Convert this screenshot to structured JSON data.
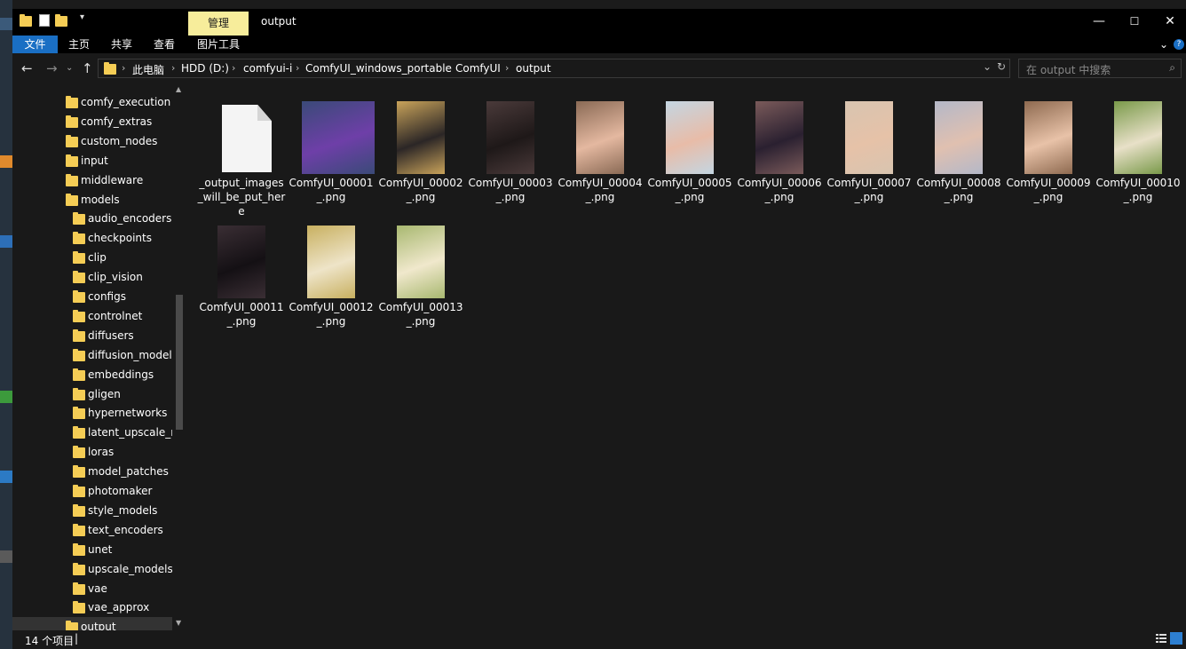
{
  "window": {
    "title": "output",
    "manage_tab": "管理",
    "controls": {
      "minimize": "—",
      "maximize": "☐",
      "close": "✕"
    }
  },
  "ribbon": {
    "tabs": [
      "文件",
      "主页",
      "共享",
      "查看",
      "图片工具"
    ],
    "active_tab_color": "#1a6fc4",
    "manage_tab_color": "#f7ed9b"
  },
  "nav": {
    "back": "←",
    "forward": "→",
    "up": "↑",
    "breadcrumb": [
      "此电脑",
      "HDD (D:)",
      "comfyui-i",
      "ComfyUI_windows_portable",
      "ComfyUI",
      "output"
    ],
    "separator": "›",
    "dropdown": "⌄",
    "refresh": "↻",
    "search_placeholder": "在 output 中搜索",
    "search_icon": "⌕"
  },
  "tree": {
    "items": [
      {
        "label": "comfy_execution",
        "level": 0
      },
      {
        "label": "comfy_extras",
        "level": 0
      },
      {
        "label": "custom_nodes",
        "level": 0
      },
      {
        "label": "input",
        "level": 0
      },
      {
        "label": "middleware",
        "level": 0
      },
      {
        "label": "models",
        "level": 0
      },
      {
        "label": "audio_encoders",
        "level": 1
      },
      {
        "label": "checkpoints",
        "level": 1
      },
      {
        "label": "clip",
        "level": 1
      },
      {
        "label": "clip_vision",
        "level": 1
      },
      {
        "label": "configs",
        "level": 1
      },
      {
        "label": "controlnet",
        "level": 1
      },
      {
        "label": "diffusers",
        "level": 1
      },
      {
        "label": "diffusion_models",
        "level": 1
      },
      {
        "label": "embeddings",
        "level": 1
      },
      {
        "label": "gligen",
        "level": 1
      },
      {
        "label": "hypernetworks",
        "level": 1
      },
      {
        "label": "latent_upscale_mc",
        "level": 1
      },
      {
        "label": "loras",
        "level": 1
      },
      {
        "label": "model_patches",
        "level": 1
      },
      {
        "label": "photomaker",
        "level": 1
      },
      {
        "label": "style_models",
        "level": 1
      },
      {
        "label": "text_encoders",
        "level": 1
      },
      {
        "label": "unet",
        "level": 1
      },
      {
        "label": "upscale_models",
        "level": 1
      },
      {
        "label": "vae",
        "level": 1
      },
      {
        "label": "vae_approx",
        "level": 1
      },
      {
        "label": "output",
        "level": 0,
        "selected": true
      }
    ]
  },
  "files": [
    {
      "label": "_output_images_will_be_put_here",
      "kind": "doc",
      "icon": "document-icon"
    },
    {
      "label": "ComfyUI_00001_.png",
      "kind": "image",
      "bg": "#3a4a78",
      "fg": "#6e3fa8"
    },
    {
      "label": "ComfyUI_00002_.png",
      "kind": "image",
      "bg": "#c9a35a",
      "fg": "#2b2626"
    },
    {
      "label": "ComfyUI_00003_.png",
      "kind": "image",
      "bg": "#4a3a3a",
      "fg": "#1e1818"
    },
    {
      "label": "ComfyUI_00004_.png",
      "kind": "image",
      "bg": "#8a6a55",
      "fg": "#e4b8a0"
    },
    {
      "label": "ComfyUI_00005_.png",
      "kind": "image",
      "bg": "#c4d6e2",
      "fg": "#e8bca8"
    },
    {
      "label": "ComfyUI_00006_.png",
      "kind": "image",
      "bg": "#7a5a5a",
      "fg": "#2a2030"
    },
    {
      "label": "ComfyUI_00007_.png",
      "kind": "image",
      "bg": "#d8c4b0",
      "fg": "#e6c2a8"
    },
    {
      "label": "ComfyUI_00008_.png",
      "kind": "image",
      "bg": "#b4b8c8",
      "fg": "#e0c0b0"
    },
    {
      "label": "ComfyUI_00009_.png",
      "kind": "image",
      "bg": "#8e6a50",
      "fg": "#e8c2a8"
    },
    {
      "label": "ComfyUI_00010_.png",
      "kind": "image",
      "bg": "#7a9a4a",
      "fg": "#e8e0c8"
    },
    {
      "label": "ComfyUI_00011_.png",
      "kind": "image",
      "bg": "#3a2e34",
      "fg": "#141014"
    },
    {
      "label": "ComfyUI_00012_.png",
      "kind": "image",
      "bg": "#c8b060",
      "fg": "#eee4c8"
    },
    {
      "label": "ComfyUI_00013_.png",
      "kind": "image",
      "bg": "#a8b870",
      "fg": "#f0e8cc"
    }
  ],
  "status": {
    "count": "14 个项目",
    "separator": "|"
  }
}
